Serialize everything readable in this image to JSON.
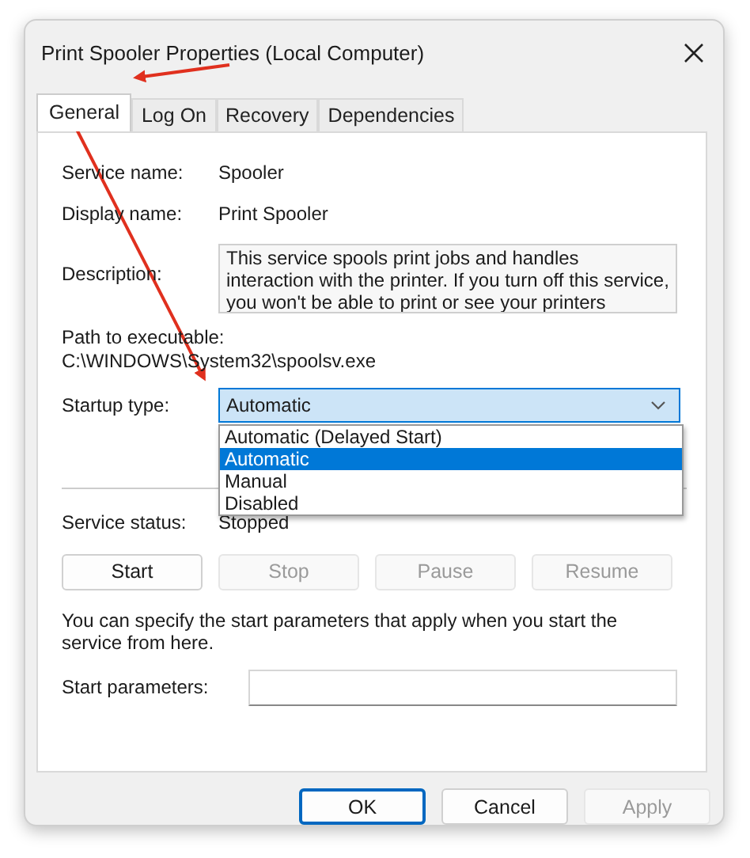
{
  "window": {
    "title": "Print Spooler Properties (Local Computer)"
  },
  "tabs": [
    {
      "label": "General",
      "selected": true
    },
    {
      "label": "Log On",
      "selected": false
    },
    {
      "label": "Recovery",
      "selected": false
    },
    {
      "label": "Dependencies",
      "selected": false
    }
  ],
  "service_name": {
    "label": "Service name:",
    "value": "Spooler"
  },
  "display_name": {
    "label": "Display name:",
    "value": "Print Spooler"
  },
  "description": {
    "label": "Description:",
    "value": "This service spools print jobs and handles interaction with the printer.  If you turn off this service, you won't be able to print or see your printers"
  },
  "path": {
    "label": "Path to executable:",
    "value": "C:\\WINDOWS\\System32\\spoolsv.exe"
  },
  "startup_type": {
    "label": "Startup type:",
    "value": "Automatic",
    "expanded": true,
    "options": [
      {
        "label": "Automatic (Delayed Start)",
        "selected": false
      },
      {
        "label": "Automatic",
        "selected": true
      },
      {
        "label": "Manual",
        "selected": false
      },
      {
        "label": "Disabled",
        "selected": false
      }
    ]
  },
  "service_status": {
    "label": "Service status:",
    "value": "Stopped"
  },
  "service_buttons": [
    {
      "label": "Start",
      "disabled": false
    },
    {
      "label": "Stop",
      "disabled": true
    },
    {
      "label": "Pause",
      "disabled": true
    },
    {
      "label": "Resume",
      "disabled": true
    }
  ],
  "hint": "You can specify the start parameters that apply when you start the service from here.",
  "start_parameters": {
    "label": "Start parameters:"
  },
  "buttons": [
    {
      "label": "OK",
      "disabled": false,
      "default": true
    },
    {
      "label": "Cancel",
      "disabled": false,
      "default": false
    },
    {
      "label": "Apply",
      "disabled": true,
      "default": false
    }
  ]
}
